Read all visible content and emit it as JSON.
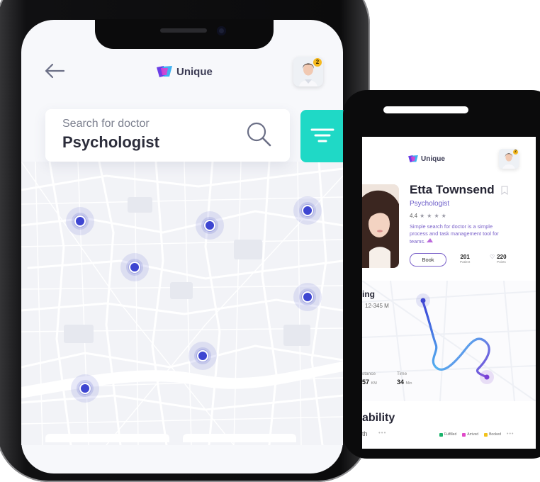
{
  "phone1": {
    "app_name": "Unique",
    "profile_badge": "2",
    "search": {
      "placeholder": "Search for doctor",
      "value": "Psychologist"
    },
    "icons": {
      "back": "arrow-left-icon",
      "search": "search-icon",
      "filter": "filter-icon",
      "logo": "unique-logo-icon"
    },
    "colors": {
      "filter_button": "#1fd9c6",
      "pin": "#3e46d1",
      "badge": "#f6b91d"
    },
    "map_pins_count": 8
  },
  "phone2": {
    "app_name": "Unique",
    "profile_badge": "2",
    "doctor": {
      "name": "Etta Townsend",
      "specialty": "Psychologist",
      "rating": "4.4",
      "stars": 4,
      "description": "Simple search for doctor is a simple process and task management tool for teams.",
      "book_label": "Book",
      "stats": [
        {
          "value": "201",
          "label": "Patient"
        },
        {
          "value": "220",
          "label": "Points"
        }
      ]
    },
    "route": {
      "heading_partial": "ing",
      "address_partial": "12-345 M",
      "distance_label_partial": "stance",
      "distance_value_partial": "57",
      "distance_unit": "KM",
      "time_label": "Time",
      "time_value": "34",
      "time_unit": "Min"
    },
    "availability": {
      "heading_partial": "ability",
      "sub_partial": "th",
      "legend": [
        {
          "label": "Fulfilled",
          "color": "#1ab36b"
        },
        {
          "label": "Arrived",
          "color": "#e049c8"
        },
        {
          "label": "Booked",
          "color": "#f2c21b"
        }
      ]
    }
  }
}
